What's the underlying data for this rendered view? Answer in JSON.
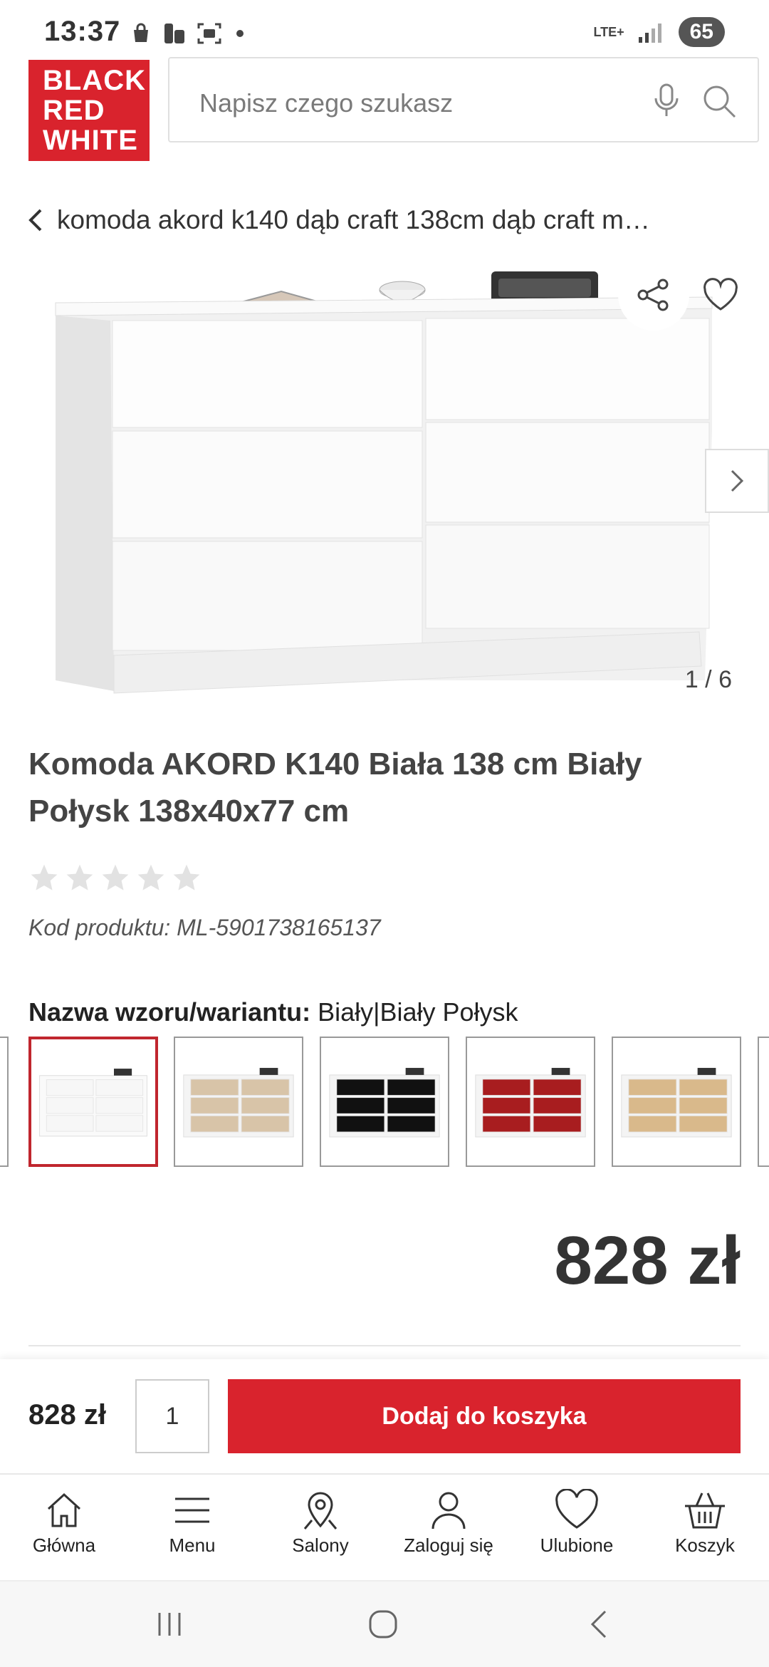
{
  "status_bar": {
    "time": "13:37",
    "network": "LTE+",
    "battery": "65"
  },
  "header": {
    "logo_lines": [
      "BLACK",
      "RED",
      "WHITE"
    ],
    "search_placeholder": "Napisz czego szukasz"
  },
  "breadcrumb": {
    "text": "komoda akord k140 dąb craft 138cm dąb craft m…"
  },
  "gallery": {
    "counter": "1 / 6"
  },
  "product": {
    "title": "Komoda AKORD K140 Biała 138 cm Biały Połysk 138x40x77 cm",
    "rating": 0,
    "code": "Kod produktu: ML-5901738165137",
    "variant_label": "Nazwa wzoru/wariantu:",
    "variant_value": "Biały|Biały Połysk",
    "price": "828 zł",
    "variants": [
      {
        "name": "biały",
        "front": "#f7f7f7",
        "body": "#fafafa",
        "active": true
      },
      {
        "name": "sonoma",
        "front": "#d8c4a8",
        "body": "#f4f4f4",
        "active": false
      },
      {
        "name": "czarny",
        "front": "#111111",
        "body": "#f4f4f4",
        "active": false
      },
      {
        "name": "czerwony",
        "front": "#a81d1f",
        "body": "#f4f4f4",
        "active": false
      },
      {
        "name": "dąb craft",
        "front": "#d9b98b",
        "body": "#f4f4f4",
        "active": false
      }
    ]
  },
  "cart_bar": {
    "price": "828 zł",
    "quantity": "1",
    "add_button": "Dodaj do koszyka"
  },
  "bottom_nav": [
    {
      "label": "Główna",
      "icon": "home-icon"
    },
    {
      "label": "Menu",
      "icon": "menu-icon"
    },
    {
      "label": "Salony",
      "icon": "map-pin-icon"
    },
    {
      "label": "Zaloguj się",
      "icon": "user-icon"
    },
    {
      "label": "Ulubione",
      "icon": "heart-icon"
    },
    {
      "label": "Koszyk",
      "icon": "basket-icon"
    }
  ],
  "colors": {
    "brand": "#d9232d",
    "active_border": "#c0262e"
  }
}
